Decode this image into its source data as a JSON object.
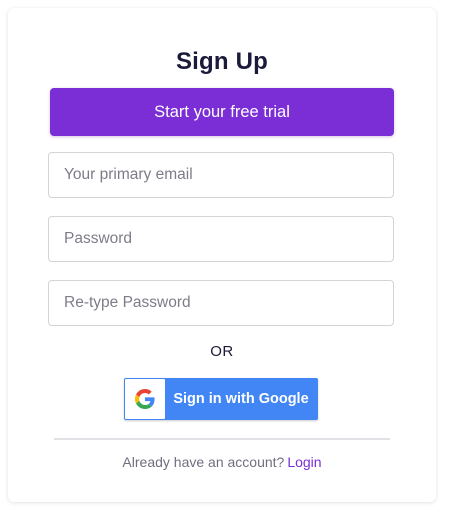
{
  "form": {
    "title": "Sign Up",
    "cta_label": "Start your free trial",
    "email_placeholder": "Your primary email",
    "password_placeholder": "Password",
    "retype_password_placeholder": "Re-type Password",
    "email_value": "",
    "password_value": "",
    "retype_password_value": ""
  },
  "divider_text": "OR",
  "google": {
    "label": "Sign in with Google",
    "icon": "google-g-icon"
  },
  "footer": {
    "prompt": "Already have an account?",
    "login_link": "Login"
  },
  "colors": {
    "primary": "#7b2dd6",
    "google_blue": "#4285f4",
    "title": "#1b1a3a"
  }
}
